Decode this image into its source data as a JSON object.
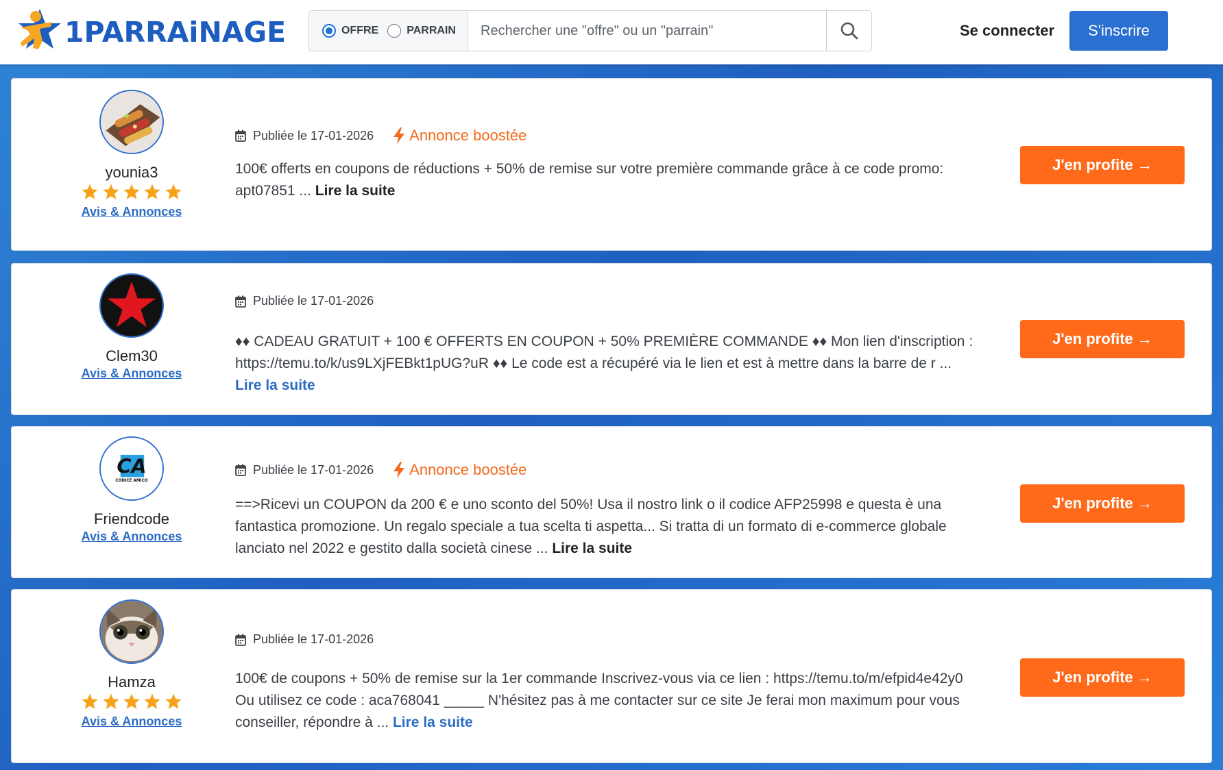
{
  "header": {
    "logo_text": "1PARRAiNAGE",
    "search": {
      "options": [
        "OFFRE",
        "PARRAIN"
      ],
      "selected": "OFFRE",
      "placeholder": "Rechercher une \"offre\" ou un \"parrain\""
    },
    "login_label": "Se connecter",
    "signup_label": "S'inscrire"
  },
  "colors": {
    "brand_blue": "#1d5dbf",
    "accent_orange": "#ff6a1a",
    "star_orange": "#f7a21b",
    "boost_orange": "#f26a1b",
    "link_blue": "#2b6cc4"
  },
  "cards": [
    {
      "username": "younia3",
      "avatar_icon": "pastries-avatar",
      "rating_stars": 5,
      "avis_label": "Avis & Annonces",
      "published": "Publiée le 17-01-2026",
      "boosted_label": "Annonce boostée",
      "description": "100€ offerts en coupons de réductions + 50% de remise sur votre première commande grâce à ce code promo: apt07851                               ... ",
      "read_more": "Lire la suite",
      "cta_label": "J'en profite →"
    },
    {
      "username": "Clem30",
      "avatar_icon": "red-star-avatar",
      "rating_stars": 0,
      "avis_label": "Avis & Annonces",
      "published": "Publiée le 17-01-2026",
      "boosted_label": "",
      "description": "♦♦ CADEAU GRATUIT + 100 € OFFERTS EN COUPON + 50% PREMIÈRE COMMANDE ♦♦ Mon lien d'inscription : https://temu.to/k/us9LXjFEBkt1pUG?uR ♦♦ Le code est a récupéré via le lien et est à mettre dans la barre de r ... ",
      "read_more": "Lire la suite",
      "cta_label": "J'en profite →"
    },
    {
      "username": "Friendcode",
      "avatar_icon": "codice-amico-avatar",
      "avatar_text": "CA",
      "avatar_subtext": "CODICE AMICO",
      "rating_stars": 0,
      "avis_label": "Avis & Annonces",
      "published": "Publiée le 17-01-2026",
      "boosted_label": "Annonce boostée",
      "description": "==>Ricevi un COUPON da 200 € e uno sconto del 50%! Usa il nostro link o il codice AFP25998 e questa è una fantastica promozione. Un regalo speciale a tua scelta ti aspetta... Si tratta di un formato di e-commerce globale lanciato nel 2022 e gestito dalla società cinese ... ",
      "read_more": "Lire la suite",
      "cta_label": "J'en profite →"
    },
    {
      "username": "Hamza",
      "avatar_icon": "cat-avatar",
      "rating_stars": 5,
      "avis_label": "Avis & Annonces",
      "published": "Publiée le 17-01-2026",
      "boosted_label": "",
      "description": "100€ de coupons + 50% de remise sur la 1er commande Inscrivez-vous via ce lien : https://temu.to/m/efpid4e42y0 Ou utilisez ce code : aca768041 _____ N'hésitez pas à me contacter sur ce site Je ferai mon maximum pour vous conseiller, répondre à ... ",
      "read_more": "Lire la suite",
      "cta_label": "J'en profite →"
    }
  ]
}
